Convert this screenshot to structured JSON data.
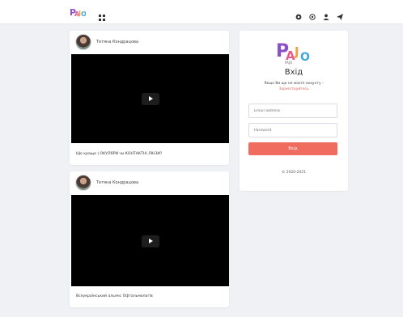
{
  "header": {
    "logo_text": "PAJO",
    "icons": [
      "grid-icon",
      "gear-icon",
      "globe-icon",
      "user-icon",
      "send-icon"
    ]
  },
  "posts": [
    {
      "author": "Тетяна Кондрацова",
      "caption": "Що краще | ОКУЛЯРИ чи КОНТАКТНІ ЛІНЗИ?"
    },
    {
      "author": "Тетяна Кондрацова",
      "caption": "Всеукраїнський альянс Офтальмологів"
    }
  ],
  "login": {
    "title": "Вхід",
    "prompt": "Якщо Ви ще не маєте акаунту -",
    "signup_link": "Зареєструйтесь",
    "email_placeholder": "Email address",
    "password_placeholder": "Password",
    "submit_label": "Вхід",
    "copyright": "© 2020-2021"
  },
  "colors": {
    "accent": "#f06c5e",
    "background": "#f0f1f5",
    "video": "#000000"
  }
}
